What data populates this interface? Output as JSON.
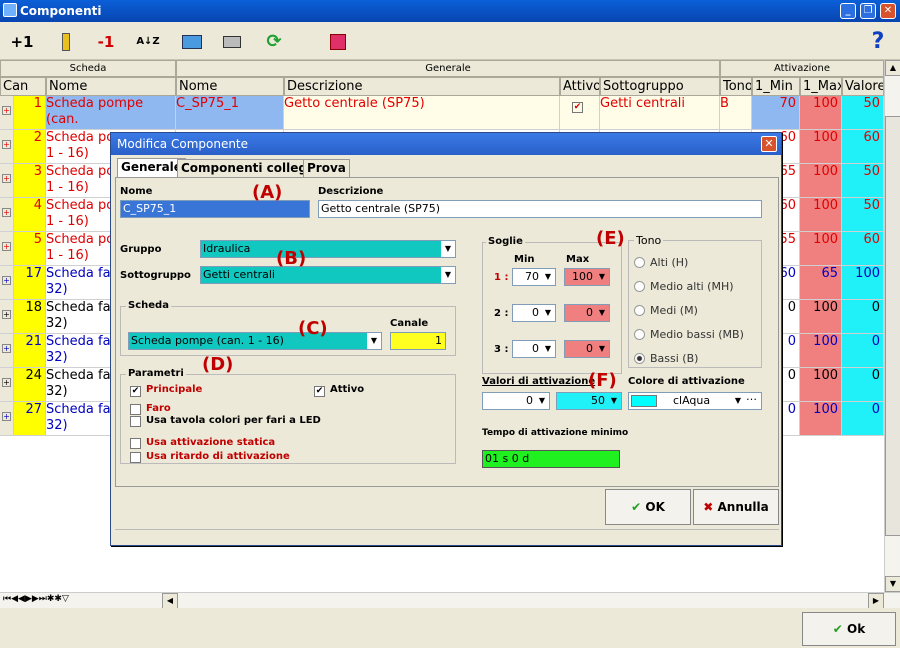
{
  "window": {
    "title": "Componenti"
  },
  "toolbar": {
    "add": "+1",
    "remove": "-1",
    "sort": "A↓Z",
    "help": "?"
  },
  "grid": {
    "groups": [
      "Scheda",
      "Generale",
      "Attivazione"
    ],
    "columns": [
      "Can",
      "Nome",
      "Nome",
      "Descrizione",
      "Attivo",
      "Sottogruppo",
      "Tono",
      "1_Min",
      "1_Max",
      "Valore"
    ],
    "rows": [
      {
        "can": "1",
        "scheda": "Scheda pompe (can.",
        "scheda2": "1 - 16)",
        "nome": "C_SP75_1",
        "desc": "Getto centrale (SP75)",
        "sotto": "Getti centrali",
        "tono": "B",
        "min": "70",
        "max": "100",
        "val": "50",
        "color": "#e00000"
      },
      {
        "can": "2",
        "scheda": "Scheda po",
        "scheda2": "1 - 16)",
        "min": "60",
        "max": "100",
        "val": "60",
        "color": "#e00000"
      },
      {
        "can": "3",
        "scheda": "Scheda po",
        "scheda2": "1 - 16)",
        "min": "65",
        "max": "100",
        "val": "50",
        "color": "#e00000"
      },
      {
        "can": "4",
        "scheda": "Scheda po",
        "scheda2": "1 - 16)",
        "min": "60",
        "max": "100",
        "val": "50",
        "color": "#e00000"
      },
      {
        "can": "5",
        "scheda": "Scheda po",
        "scheda2": "1 - 16)",
        "min": "55",
        "max": "100",
        "val": "60",
        "color": "#e00000"
      },
      {
        "can": "17",
        "scheda": "Scheda fa",
        "scheda2": "32)",
        "min": "60",
        "max": "65",
        "val": "100",
        "color": "#0000c0"
      },
      {
        "can": "18",
        "scheda": "Scheda fa",
        "scheda2": "32)",
        "min": "0",
        "max": "100",
        "val": "0",
        "color": "#000000"
      },
      {
        "can": "21",
        "scheda": "Scheda fa",
        "scheda2": "32)",
        "min": "0",
        "max": "100",
        "val": "0",
        "color": "#0000c0"
      },
      {
        "can": "24",
        "scheda": "Scheda fa",
        "scheda2": "32)",
        "min": "0",
        "max": "100",
        "val": "0",
        "color": "#000000"
      },
      {
        "can": "27",
        "scheda": "Scheda fa",
        "scheda2": "32)",
        "min": "0",
        "max": "100",
        "val": "0",
        "color": "#0000c0"
      }
    ]
  },
  "dialog": {
    "title": "Modifica Componente",
    "tabs": [
      "Generale",
      "Componenti collegati",
      "Prova"
    ],
    "nome_label": "Nome",
    "nome_value": "C_SP75_1",
    "desc_label": "Descrizione",
    "desc_value": "Getto centrale (SP75)",
    "gruppo_label": "Gruppo",
    "gruppo_value": "Idraulica",
    "sotto_label": "Sottogruppo",
    "sotto_value": "Getti centrali",
    "scheda_label": "Scheda",
    "scheda_value": "Scheda pompe (can. 1 - 16)",
    "canale_label": "Canale",
    "canale_value": "1",
    "parametri_label": "Parametri",
    "principale": "Principale",
    "attivo": "Attivo",
    "faro": "Faro",
    "led": "Usa tavola colori per fari a LED",
    "statica": "Usa attivazione statica",
    "ritardo": "Usa ritardo di attivazione",
    "soglie_label": "Soglie",
    "min_label": "Min",
    "max_label": "Max",
    "soglie": [
      {
        "n": "1 :",
        "min": "70",
        "max": "100"
      },
      {
        "n": "2 :",
        "min": "0",
        "max": "0"
      },
      {
        "n": "3 :",
        "min": "0",
        "max": "0"
      }
    ],
    "tono_label": "Tono",
    "toni": [
      "Alti (H)",
      "Medio alti (MH)",
      "Medi (M)",
      "Medio bassi (MB)",
      "Bassi (B)"
    ],
    "valori_label": "Valori di attivazione",
    "val1": "0",
    "val2": "50",
    "colore_label": "Colore di attivazione",
    "colore_value": "clAqua",
    "tempo_label": "Tempo di attivazione minimo",
    "tempo_value": "01 s 0 d",
    "ok": "OK",
    "annulla": "Annulla"
  },
  "marks": [
    "(A)",
    "(B)",
    "(C)",
    "(D)",
    "(E)",
    "(F)"
  ],
  "bottom": {
    "ok": "Ok"
  }
}
